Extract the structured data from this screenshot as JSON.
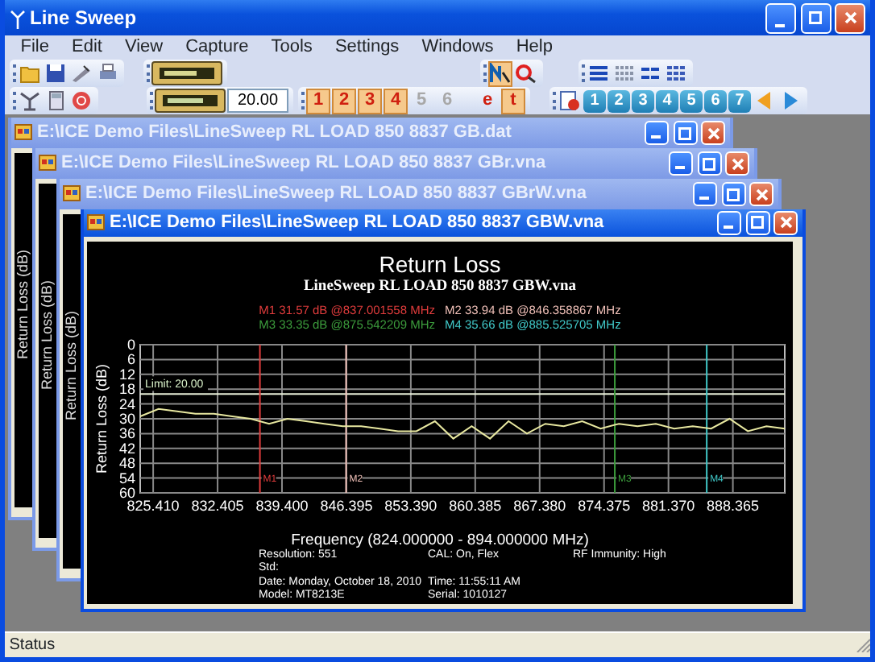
{
  "window": {
    "title": "Line Sweep"
  },
  "menu": [
    "File",
    "Edit",
    "View",
    "Capture",
    "Tools",
    "Settings",
    "Windows",
    "Help"
  ],
  "toolbar": {
    "limit_value": "20.00",
    "trace_buttons": [
      {
        "label": "1",
        "pressed": true,
        "disabled": false
      },
      {
        "label": "2",
        "pressed": true,
        "disabled": false
      },
      {
        "label": "3",
        "pressed": true,
        "disabled": false
      },
      {
        "label": "4",
        "pressed": true,
        "disabled": false
      },
      {
        "label": "5",
        "pressed": false,
        "disabled": true
      },
      {
        "label": "6",
        "pressed": false,
        "disabled": true
      }
    ],
    "mode_buttons": [
      {
        "label": "e",
        "pressed": false
      },
      {
        "label": "t",
        "pressed": true
      }
    ],
    "window_buttons": [
      "1",
      "2",
      "3",
      "4",
      "5",
      "6",
      "7"
    ]
  },
  "child_windows": [
    {
      "title": "E:\\ICE Demo Files\\LineSweep RL LOAD 850 8837 GB.dat",
      "active": false,
      "axis_label": "Return Loss (dB)"
    },
    {
      "title": "E:\\ICE Demo Files\\LineSweep RL LOAD 850 8837 GBr.vna",
      "active": false,
      "axis_label": "Return Loss (dB)"
    },
    {
      "title": "E:\\ICE Demo Files\\LineSweep RL LOAD 850 8837 GBrW.vna",
      "active": false,
      "axis_label": "Return Loss (dB)"
    },
    {
      "title": "E:\\ICE Demo Files\\LineSweep RL LOAD 850 8837 GBW.vna",
      "active": true
    }
  ],
  "chart": {
    "title": "Return Loss",
    "subtitle": "LineSweep RL LOAD 850 8837 GBW.vna",
    "marker_readouts": [
      {
        "text": "M1 31.57 dB @837.001558 MHz",
        "color": "#e03c3c"
      },
      {
        "text": "M2 33.94 dB @846.358867 MHz",
        "color": "#f0c0b8"
      },
      {
        "text": "M3 33.35 dB @875.542209 MHz",
        "color": "#3c9c3c"
      },
      {
        "text": "M4 35.66 dB @885.525705 MHz",
        "color": "#40c8c8"
      }
    ],
    "chart_data": {
      "type": "line",
      "xlabel": "Frequency (824.000000 - 894.000000 MHz)",
      "ylabel": "Return Loss (dB)",
      "x": [
        824,
        826,
        828,
        830,
        832,
        834,
        836,
        838,
        840,
        842,
        844,
        846,
        848,
        850,
        852,
        854,
        856,
        858,
        860,
        862,
        864,
        866,
        868,
        870,
        872,
        874,
        876,
        878,
        880,
        882,
        884,
        886,
        888,
        890,
        892,
        894
      ],
      "series": [
        {
          "color": "#e8e8a0",
          "values": [
            29,
            26,
            27,
            28,
            28,
            29,
            30,
            32,
            30,
            31,
            32,
            33,
            33,
            34,
            35,
            35,
            31,
            38,
            33,
            38,
            31,
            36,
            32,
            33,
            31,
            34,
            32,
            33,
            32,
            34,
            33,
            34,
            30,
            35,
            33,
            34
          ]
        }
      ],
      "xlim": [
        824,
        894
      ],
      "ylim": [
        60,
        0
      ],
      "grid": true,
      "xticks": [
        {
          "value": 825.41,
          "label": "825.410"
        },
        {
          "value": 832.405,
          "label": "832.405"
        },
        {
          "value": 839.4,
          "label": "839.400"
        },
        {
          "value": 846.395,
          "label": "846.395"
        },
        {
          "value": 853.39,
          "label": "853.390"
        },
        {
          "value": 860.385,
          "label": "860.385"
        },
        {
          "value": 867.38,
          "label": "867.380"
        },
        {
          "value": 874.375,
          "label": "874.375"
        },
        {
          "value": 881.37,
          "label": "881.370"
        },
        {
          "value": 888.365,
          "label": "888.365"
        }
      ],
      "yticks": [
        0,
        6,
        12,
        18,
        24,
        30,
        36,
        42,
        48,
        54,
        60
      ],
      "ref_lines": [
        {
          "axis": "y",
          "value": 20,
          "label": "Limit: 20.00"
        },
        {
          "axis": "x",
          "value": 837.001558,
          "label": "M1"
        },
        {
          "axis": "x",
          "value": 846.358867,
          "label": "M2"
        },
        {
          "axis": "x",
          "value": 875.542209,
          "label": "M3"
        },
        {
          "axis": "x",
          "value": 885.525705,
          "label": "M4"
        }
      ]
    },
    "info": [
      [
        "Resolution: 551",
        "CAL: On, Flex",
        "RF Immunity: High"
      ],
      [
        "Std:"
      ],
      [
        "Date: Monday, October 18, 2010",
        "Time: 11:55:11 AM"
      ],
      [
        "Model: MT8213E",
        "Serial: 1010127"
      ]
    ]
  },
  "status_bar": {
    "text": "Status"
  }
}
